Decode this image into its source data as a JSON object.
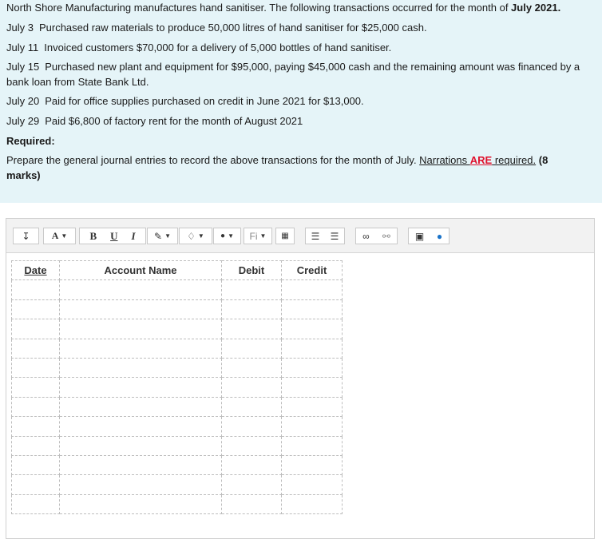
{
  "question": {
    "intro": {
      "text": "North Shore Manufacturing manufactures hand sanitiser.  The following transactions occurred for the month of ",
      "bold": "July 2021."
    },
    "transactions": [
      {
        "date": "July 3",
        "text": "Purchased raw materials to produce 50,000 litres of hand sanitiser for  $25,000 cash."
      },
      {
        "date": "July 11",
        "text": "Invoiced customers $70,000 for a delivery of 5,000 bottles of hand sanitiser."
      },
      {
        "date": "July 15",
        "text": "Purchased new plant and equipment for $95,000, paying $45,000 cash and the remaining amount was financed by a",
        "text2": "bank loan from State Bank Ltd."
      },
      {
        "date": "July 20",
        "text": "Paid for office supplies purchased on credit in June 2021 for $13,000."
      },
      {
        "date": "July 29",
        "text": "Paid $6,800 of factory rent for the month of August 2021"
      }
    ],
    "required_label": "Required:",
    "prompt": {
      "text": "Prepare the general journal entries to record the above transactions for the month of July. ",
      "link1": "Narrations ",
      "link_red": "ARE",
      "link2": " required.",
      "marks": " (8",
      "marks2": "marks)"
    }
  },
  "toolbar": {
    "items": [
      {
        "name": "paragraph-format-icon",
        "label": "↧"
      },
      {
        "name": "font-size-icon",
        "label": "A"
      },
      {
        "name": "bold-button",
        "label": "B"
      },
      {
        "name": "underline-button",
        "label": "U"
      },
      {
        "name": "italic-button",
        "label": "I"
      },
      {
        "name": "text-color-icon",
        "label": "✎"
      },
      {
        "name": "highlight-icon",
        "label": "♢"
      },
      {
        "name": "fill-color-icon",
        "label": "●"
      },
      {
        "name": "font-family-icon",
        "label": "Fi"
      },
      {
        "name": "special-character-icon",
        "label": "▦"
      },
      {
        "name": "bulleted-list-icon",
        "label": "☰"
      },
      {
        "name": "numbered-list-icon",
        "label": "☰"
      },
      {
        "name": "insert-link-icon",
        "label": "∞"
      },
      {
        "name": "unlink-icon",
        "label": "⚯"
      },
      {
        "name": "insert-image-icon",
        "label": "▣"
      },
      {
        "name": "equation-icon",
        "label": "●"
      }
    ]
  },
  "journal": {
    "headers": [
      "Date",
      "Account Name",
      "Debit",
      "Credit"
    ]
  }
}
